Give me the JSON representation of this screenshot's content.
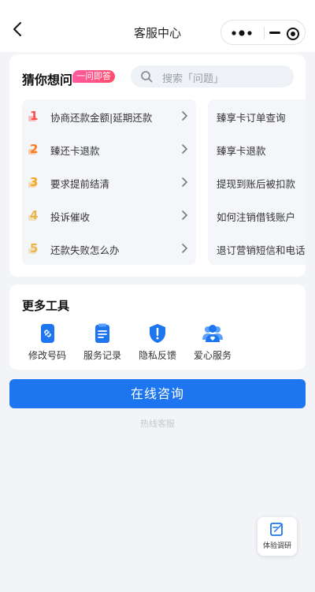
{
  "nav": {
    "title": "客服中心",
    "back_icon": "chevron-left-icon",
    "menu": {
      "more_icon": "more-dots-icon",
      "minimize_icon": "minus-icon",
      "close_icon": "target-icon"
    }
  },
  "guess": {
    "title": "猜你想问",
    "tag": "一问即答",
    "search": {
      "placeholder": "搜索「问题」",
      "icon": "search-icon"
    },
    "left_items": [
      {
        "num": "1",
        "label": "协商还款金额|延期还款",
        "color": "#ff4d4f"
      },
      {
        "num": "2",
        "label": "臻还卡退款",
        "color": "#ff7a1a"
      },
      {
        "num": "3",
        "label": "要求提前结清",
        "color": "#f5a623"
      },
      {
        "num": "4",
        "label": "投诉催收",
        "color": "#e8b64c"
      },
      {
        "num": "5",
        "label": "还款失败怎么办",
        "color": "#e8b64c"
      }
    ],
    "right_items": [
      {
        "label": "臻享卡订单查询"
      },
      {
        "label": "臻享卡退款"
      },
      {
        "label": "提现到账后被扣款"
      },
      {
        "label": "如何注销借钱账户"
      },
      {
        "label": "退订营销短信和电话"
      }
    ]
  },
  "tools": {
    "title": "更多工具",
    "items": [
      {
        "label": "修改号码",
        "icon": "phone-edit-icon"
      },
      {
        "label": "服务记录",
        "icon": "document-icon"
      },
      {
        "label": "隐私反馈",
        "icon": "shield-alert-icon"
      },
      {
        "label": "爱心服务",
        "icon": "users-heart-icon"
      }
    ]
  },
  "actions": {
    "consult": "在线咨询",
    "hotline": "热线客服"
  },
  "survey": {
    "label": "体验调研",
    "icon": "edit-note-icon"
  },
  "colors": {
    "primary": "#1d76f0",
    "tag": "#ff4d7d"
  }
}
